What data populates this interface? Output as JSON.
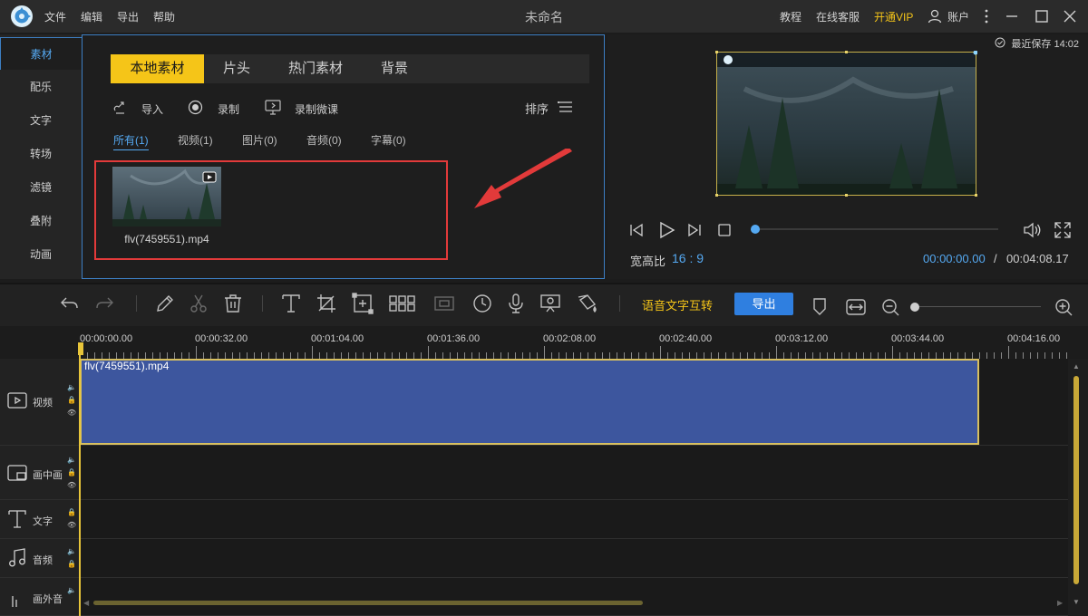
{
  "app": {
    "title": "未命名",
    "menu": [
      "文件",
      "编辑",
      "导出",
      "帮助"
    ],
    "top_links": {
      "tutorial": "教程",
      "support": "在线客服",
      "vip": "开通VIP",
      "account": "账户"
    }
  },
  "sidebar": {
    "items": [
      {
        "label": "素材",
        "active": true
      },
      {
        "label": "配乐"
      },
      {
        "label": "文字"
      },
      {
        "label": "转场"
      },
      {
        "label": "滤镜"
      },
      {
        "label": "叠附"
      },
      {
        "label": "动画"
      }
    ]
  },
  "media": {
    "tabs": [
      "本地素材",
      "片头",
      "热门素材",
      "背景"
    ],
    "tools": {
      "import": "导入",
      "record": "录制",
      "record_micro": "录制微课",
      "sort": "排序"
    },
    "filters": [
      "所有(1)",
      "视频(1)",
      "图片(0)",
      "音频(0)",
      "字幕(0)"
    ],
    "items": [
      {
        "name": "flv(7459551).mp4"
      }
    ]
  },
  "preview": {
    "save_status": "最近保存 14:02",
    "aspect_label": "宽高比",
    "aspect_value": "16 : 9",
    "current_time": "00:00:00.00",
    "separator": "/",
    "total_time": "00:04:08.17",
    "progress": 0
  },
  "toolbar": {
    "speech_text": "语音文字互转",
    "export": "导出"
  },
  "timeline": {
    "ticks": [
      "00:00:00.00",
      "00:00:32.00",
      "00:01:04.00",
      "00:01:36.00",
      "00:02:08.00",
      "00:02:40.00",
      "00:03:12.00",
      "00:03:44.00",
      "00:04:16.00"
    ],
    "tracks": [
      {
        "label": "视频"
      },
      {
        "label": "画中画"
      },
      {
        "label": "文字"
      },
      {
        "label": "音频"
      },
      {
        "label": "画外音"
      }
    ],
    "clip_name": "flv(7459551).mp4"
  },
  "colors": {
    "accent_yellow": "#f5c518",
    "accent_blue": "#55a9f2",
    "clip": "#3d569e",
    "highlight": "#e23a3a"
  }
}
